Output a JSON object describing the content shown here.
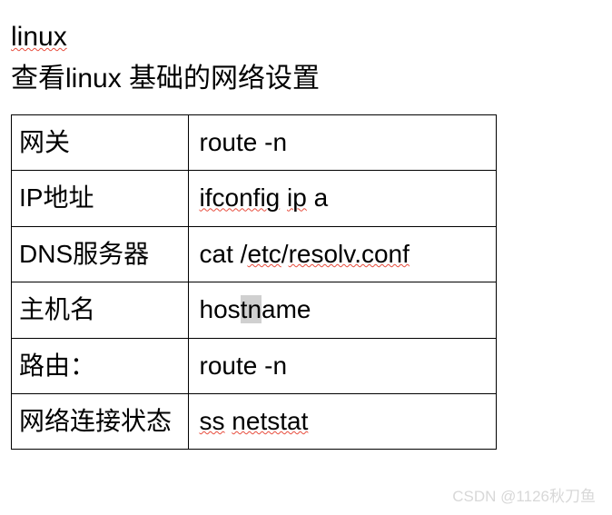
{
  "title_segments": {
    "s1": "linux"
  },
  "subtitle": "查看linux  基础的网络设置",
  "rows": [
    {
      "label": "网关",
      "cmd_plain": " route -n"
    },
    {
      "label": "IP地址",
      "cmd_segments": {
        "s1": " ",
        "s2": "ifconfig",
        "s3": "    ",
        "s4": "ip",
        "s5": "  a"
      }
    },
    {
      "label": "DNS服务器",
      "cmd_segments": {
        "s1": " cat /",
        "s2": "etc",
        "s3": "/",
        "s4": "resolv.conf"
      }
    },
    {
      "label": "主机名",
      "cmd_segments": {
        "s1": "hos",
        "s2": "tn",
        "s3": "ame"
      }
    },
    {
      "label": "路由：",
      "cmd_plain": " route -n"
    },
    {
      "label": "网络连接状态",
      "cmd_segments": {
        "s1": " ",
        "s2": "ss",
        "s3": "    ",
        "s4": "netstat"
      }
    }
  ],
  "watermark": "CSDN @1126秋刀鱼"
}
